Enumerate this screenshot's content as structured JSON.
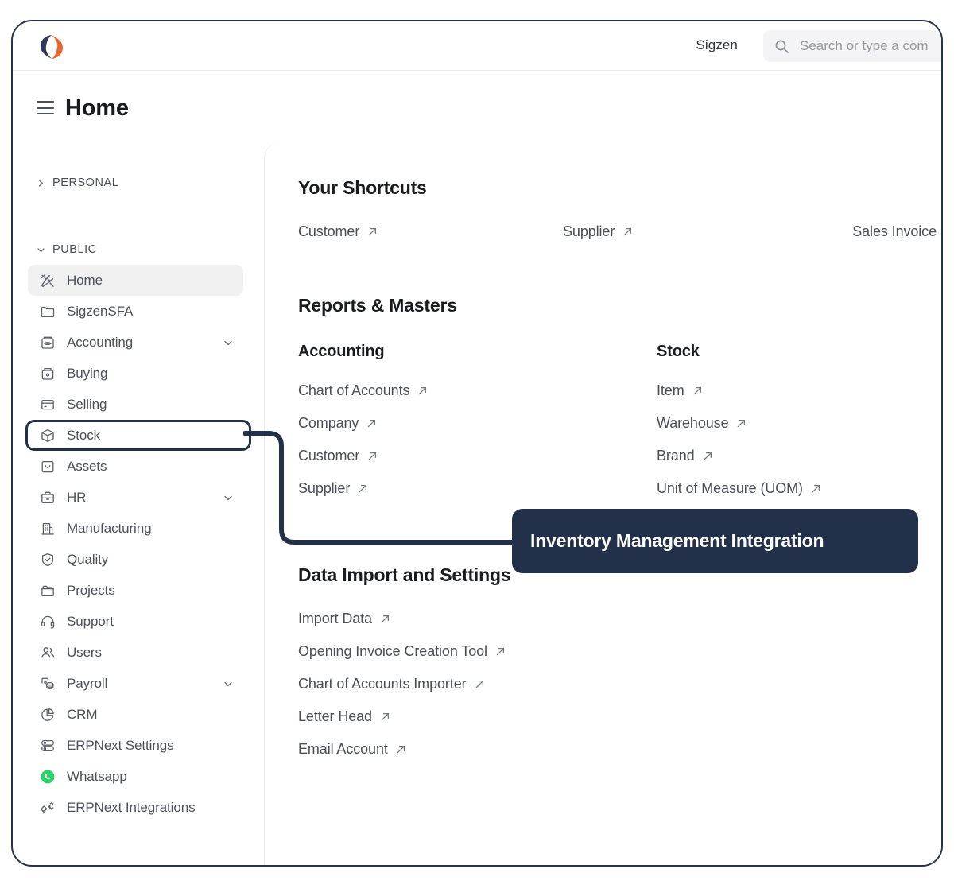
{
  "topbar": {
    "logo_icon": "sigzen-logo-icon",
    "brand": "Sigzen",
    "search_icon": "search-icon",
    "search_placeholder": "Search or type a com",
    "search_value": ""
  },
  "page": {
    "menu_icon": "hamburger-icon",
    "title": "Home"
  },
  "sidebar": {
    "groups": [
      {
        "label": "PERSONAL",
        "icon": "chevron-right-icon",
        "expanded": false
      },
      {
        "label": "PUBLIC",
        "icon": "chevron-down-icon",
        "expanded": true
      }
    ],
    "items": [
      {
        "label": "Home",
        "icon": "tools-icon",
        "state": "selected",
        "caret": false
      },
      {
        "label": "SigzenSFA",
        "icon": "folder-icon",
        "state": "normal",
        "caret": false
      },
      {
        "label": "Accounting",
        "icon": "ledger-icon",
        "state": "normal",
        "caret": true
      },
      {
        "label": "Buying",
        "icon": "buying-icon",
        "state": "normal",
        "caret": false
      },
      {
        "label": "Selling",
        "icon": "selling-icon",
        "state": "normal",
        "caret": false
      },
      {
        "label": "Stock",
        "icon": "box-icon",
        "state": "highlight",
        "caret": false
      },
      {
        "label": "Assets",
        "icon": "assets-icon",
        "state": "normal",
        "caret": false
      },
      {
        "label": "HR",
        "icon": "briefcase-icon",
        "state": "normal",
        "caret": true
      },
      {
        "label": "Manufacturing",
        "icon": "factory-icon",
        "state": "normal",
        "caret": false
      },
      {
        "label": "Quality",
        "icon": "shield-check-icon",
        "state": "normal",
        "caret": false
      },
      {
        "label": "Projects",
        "icon": "folder-open-icon",
        "state": "normal",
        "caret": false
      },
      {
        "label": "Support",
        "icon": "headset-icon",
        "state": "normal",
        "caret": false
      },
      {
        "label": "Users",
        "icon": "users-icon",
        "state": "normal",
        "caret": false
      },
      {
        "label": "Payroll",
        "icon": "payroll-icon",
        "state": "normal",
        "caret": true
      },
      {
        "label": "CRM",
        "icon": "pie-chart-icon",
        "state": "normal",
        "caret": false
      },
      {
        "label": "ERPNext Settings",
        "icon": "server-icon",
        "state": "normal",
        "caret": false
      },
      {
        "label": "Whatsapp",
        "icon": "whatsapp-icon",
        "state": "normal",
        "caret": false
      },
      {
        "label": "ERPNext Integrations",
        "icon": "plug-icon",
        "state": "normal",
        "caret": false
      }
    ]
  },
  "main": {
    "shortcuts": {
      "title": "Your Shortcuts",
      "items": [
        {
          "label": "Customer",
          "icon": "external-link-icon"
        },
        {
          "label": "Supplier",
          "icon": "external-link-icon"
        },
        {
          "label": "Sales Invoice",
          "icon": "external-link-icon"
        }
      ]
    },
    "reports": {
      "title": "Reports & Masters",
      "columns": [
        {
          "title": "Accounting",
          "links": [
            {
              "label": "Chart of Accounts",
              "icon": "external-link-icon"
            },
            {
              "label": "Company",
              "icon": "external-link-icon"
            },
            {
              "label": "Customer",
              "icon": "external-link-icon"
            },
            {
              "label": "Supplier",
              "icon": "external-link-icon"
            }
          ]
        },
        {
          "title": "Stock",
          "links": [
            {
              "label": "Item",
              "icon": "external-link-icon"
            },
            {
              "label": "Warehouse",
              "icon": "external-link-icon"
            },
            {
              "label": "Brand",
              "icon": "external-link-icon"
            },
            {
              "label": "Unit of Measure (UOM)",
              "icon": "external-link-icon"
            }
          ]
        }
      ]
    },
    "data_import": {
      "title": "Data Import and Settings",
      "links": [
        {
          "label": "Import Data",
          "icon": "external-link-icon"
        },
        {
          "label": "Opening Invoice Creation Tool",
          "icon": "external-link-icon"
        },
        {
          "label": "Chart of Accounts Importer",
          "icon": "external-link-icon"
        },
        {
          "label": "Letter Head",
          "icon": "external-link-icon"
        },
        {
          "label": "Email Account",
          "icon": "external-link-icon"
        }
      ]
    }
  },
  "callout": {
    "text": "Inventory Management Integration",
    "target_item": "Stock"
  },
  "colors": {
    "navy": "#22304a",
    "orange": "#ec6730",
    "whatsapp_green": "#25d366",
    "text": "#4b4e56",
    "heading": "#1a1b1f",
    "soft_bg": "#f0f0f1"
  }
}
